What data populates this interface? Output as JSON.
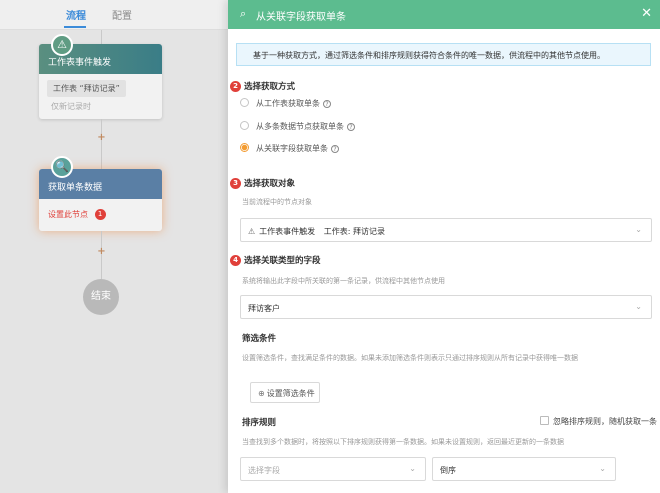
{
  "canvas": {
    "tabs": [
      {
        "label": "流程"
      },
      {
        "label": "配置"
      }
    ],
    "trigger_node": {
      "title": "工作表事件触发",
      "pill": "工作表 “拜访记录”",
      "hint": "仅新记录时"
    },
    "fetch_node": {
      "title": "获取单条数据",
      "link": "设置此节点",
      "badge": "1"
    },
    "plus_symbol": "+",
    "end_label": "结束"
  },
  "panel": {
    "title": "从关联字段获取单条",
    "info": "基于一种获取方式，通过筛选条件和排序规则获得符合条件的唯一数据，供流程中的其他节点使用。",
    "method": {
      "badge": "2",
      "label": "选择获取方式",
      "options": [
        {
          "label": "从工作表获取单条",
          "selected": false
        },
        {
          "label": "从多条数据节点获取单条",
          "selected": false
        },
        {
          "label": "从关联字段获取单条",
          "selected": true
        }
      ]
    },
    "target": {
      "badge": "3",
      "label": "选择获取对象",
      "desc": "当前流程中的节点对象",
      "value": "工作表事件触发",
      "value2": "工作表: 拜访记录"
    },
    "field": {
      "badge": "4",
      "label": "选择关联类型的字段",
      "desc": "系统将输出此字段中所关联的第一条记录，供流程中其他节点使用",
      "value": "拜访客户"
    },
    "filter": {
      "label": "筛选条件",
      "desc": "设置筛选条件，查找满足条件的数据。如果未添加筛选条件则表示只通过排序规则从所有记录中获得唯一数据",
      "button": "设置筛选条件"
    },
    "sort": {
      "label": "排序规则",
      "checkbox": "忽略排序规则，随机获取一条",
      "desc": "当查找到多个数据时，将按照以下排序规则获得第一条数据。如果未设置规则，返回最近更新的一条数据",
      "field_placeholder": "选择字段",
      "order": "倒序"
    }
  },
  "colors": {
    "header": "#5cbc8f",
    "accent": "#f39c32",
    "badge": "#e0403a",
    "info_bg": "#eaf6fd"
  },
  "icons": [
    "search-icon",
    "close-icon",
    "question-icon",
    "chevron-down-icon",
    "plus-circle-icon",
    "trigger-icon"
  ]
}
